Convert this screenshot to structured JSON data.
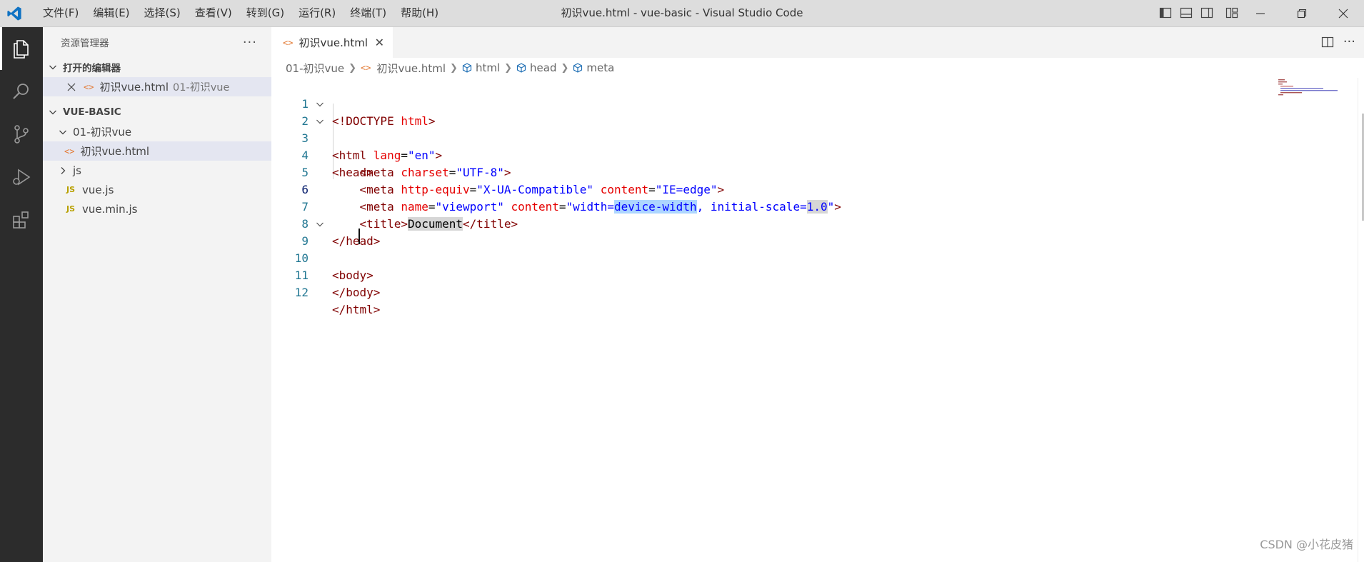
{
  "window": {
    "title": "初识vue.html - vue-basic - Visual Studio Code",
    "menu": [
      "文件(F)",
      "编辑(E)",
      "选择(S)",
      "查看(V)",
      "转到(G)",
      "运行(R)",
      "终端(T)",
      "帮助(H)"
    ],
    "accent": "#007acc"
  },
  "sidebar": {
    "title": "资源管理器",
    "more": "···",
    "open_editors": {
      "heading": "打开的编辑器",
      "items": [
        {
          "name": "初识vue.html",
          "folder": "01-初识vue"
        }
      ]
    },
    "workspace": {
      "heading": "VUE-BASIC",
      "folder1": {
        "name": "01-初识vue",
        "files": [
          "初识vue.html"
        ]
      },
      "folder2": {
        "name": "js",
        "files": [
          "vue.js",
          "vue.min.js"
        ]
      },
      "js_badge": "JS"
    }
  },
  "tabs": [
    {
      "label": "初识vue.html",
      "active": true
    }
  ],
  "breadcrumb": [
    "01-初识vue",
    "初识vue.html",
    "html",
    "head",
    "meta"
  ],
  "editor": {
    "line_numbers": [
      "1",
      "2",
      "3",
      "4",
      "5",
      "6",
      "7",
      "8",
      "9",
      "10",
      "11",
      "12"
    ],
    "current_line": 6,
    "lines": [
      "<!DOCTYPE html>",
      "<html lang=\"en\">",
      "<head>",
      "    <meta charset=\"UTF-8\">",
      "    <meta http-equiv=\"X-UA-Compatible\" content=\"IE=edge\">",
      "    <meta name=\"viewport\" content=\"width=device-width, initial-scale=1.0\">",
      "    <title>Document</title>",
      "</head>",
      "<body>",
      "",
      "</body>",
      "</html>"
    ]
  },
  "watermark": "CSDN @小花皮猪"
}
